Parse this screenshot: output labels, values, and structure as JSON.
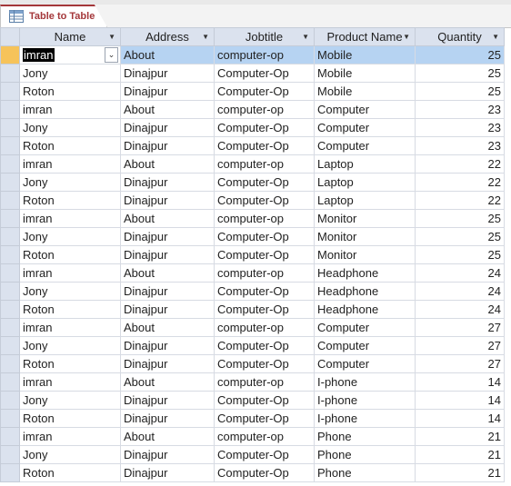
{
  "tab": {
    "label": "Table to Table",
    "icon": "table-icon"
  },
  "columns": [
    "Name",
    "Address",
    "Jobtitle",
    "Product Name",
    "Quantity"
  ],
  "rows": [
    [
      "imran",
      "About",
      "computer-op",
      "Mobile",
      "25"
    ],
    [
      "Jony",
      "Dinajpur",
      "Computer-Op",
      "Mobile",
      "25"
    ],
    [
      "Roton",
      "Dinajpur",
      "Computer-Op",
      "Mobile",
      "25"
    ],
    [
      "imran",
      "About",
      "computer-op",
      "Computer",
      "23"
    ],
    [
      "Jony",
      "Dinajpur",
      "Computer-Op",
      "Computer",
      "23"
    ],
    [
      "Roton",
      "Dinajpur",
      "Computer-Op",
      "Computer",
      "23"
    ],
    [
      "imran",
      "About",
      "computer-op",
      "Laptop",
      "22"
    ],
    [
      "Jony",
      "Dinajpur",
      "Computer-Op",
      "Laptop",
      "22"
    ],
    [
      "Roton",
      "Dinajpur",
      "Computer-Op",
      "Laptop",
      "22"
    ],
    [
      "imran",
      "About",
      "computer-op",
      "Monitor",
      "25"
    ],
    [
      "Jony",
      "Dinajpur",
      "Computer-Op",
      "Monitor",
      "25"
    ],
    [
      "Roton",
      "Dinajpur",
      "Computer-Op",
      "Monitor",
      "25"
    ],
    [
      "imran",
      "About",
      "computer-op",
      "Headphone",
      "24"
    ],
    [
      "Jony",
      "Dinajpur",
      "Computer-Op",
      "Headphone",
      "24"
    ],
    [
      "Roton",
      "Dinajpur",
      "Computer-Op",
      "Headphone",
      "24"
    ],
    [
      "imran",
      "About",
      "computer-op",
      "Computer",
      "27"
    ],
    [
      "Jony",
      "Dinajpur",
      "Computer-Op",
      "Computer",
      "27"
    ],
    [
      "Roton",
      "Dinajpur",
      "Computer-Op",
      "Computer",
      "27"
    ],
    [
      "imran",
      "About",
      "computer-op",
      "I-phone",
      "14"
    ],
    [
      "Jony",
      "Dinajpur",
      "Computer-Op",
      "I-phone",
      "14"
    ],
    [
      "Roton",
      "Dinajpur",
      "Computer-Op",
      "I-phone",
      "14"
    ],
    [
      "imran",
      "About",
      "computer-op",
      "Phone",
      "21"
    ],
    [
      "Jony",
      "Dinajpur",
      "Computer-Op",
      "Phone",
      "21"
    ],
    [
      "Roton",
      "Dinajpur",
      "Computer-Op",
      "Phone",
      "21"
    ]
  ],
  "active_row": 0,
  "colors": {
    "tab_accent": "#a4373a",
    "header_bg": "#dbe2ee",
    "selected_row": "#b6d3f2",
    "record_selector_active": "#f6c35a"
  }
}
